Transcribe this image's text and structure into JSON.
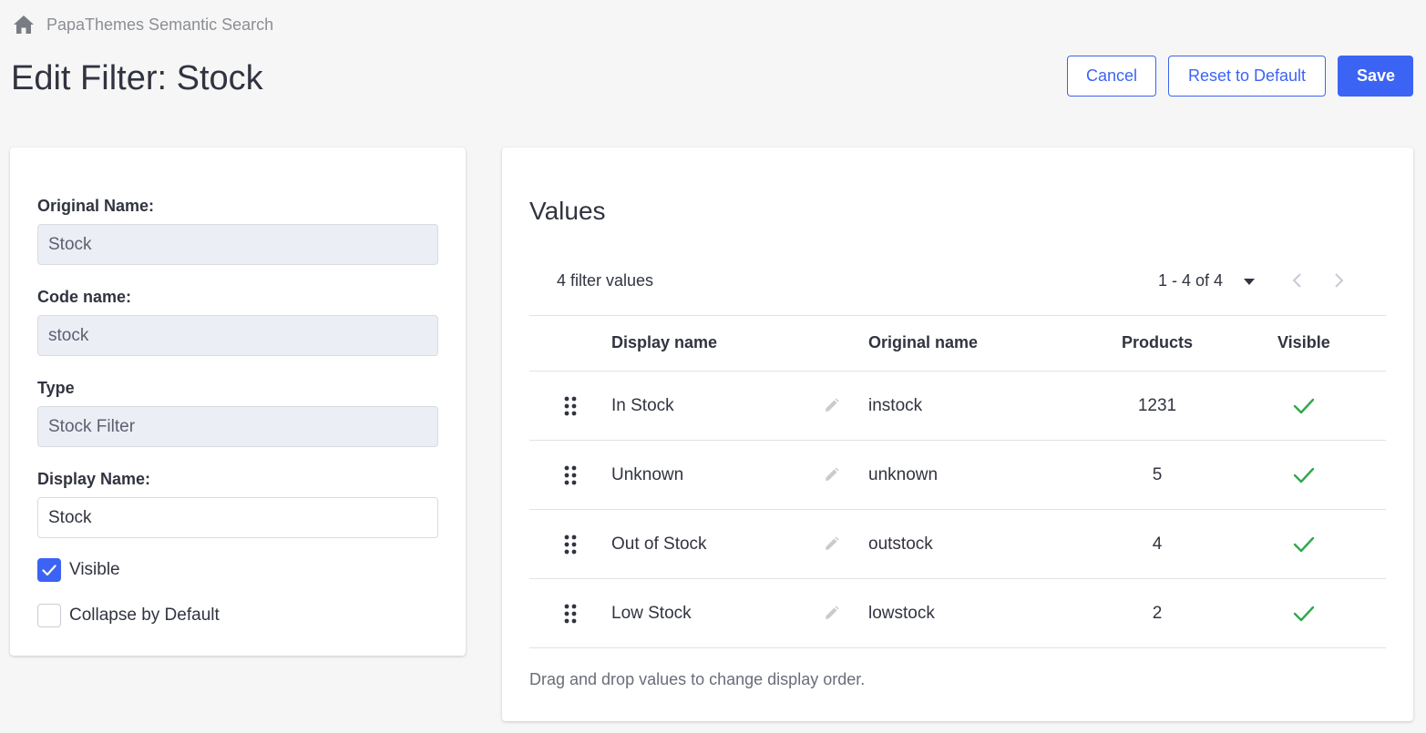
{
  "breadcrumb": {
    "label": "PapaThemes Semantic Search",
    "icon": "home-icon"
  },
  "page": {
    "title": "Edit Filter: Stock"
  },
  "actions": {
    "cancel": "Cancel",
    "reset": "Reset to Default",
    "save": "Save"
  },
  "colors": {
    "accent": "#3c64f4",
    "success": "#2fa84f"
  },
  "form": {
    "original_name": {
      "label": "Original Name:",
      "value": "Stock"
    },
    "code_name": {
      "label": "Code name:",
      "value": "stock"
    },
    "type": {
      "label": "Type",
      "value": "Stock Filter"
    },
    "display_name": {
      "label": "Display Name:",
      "value": "Stock"
    },
    "visible": {
      "label": "Visible",
      "checked": true
    },
    "collapse": {
      "label": "Collapse by Default",
      "checked": false
    }
  },
  "values": {
    "title": "Values",
    "count_text": "4 filter values",
    "pagination": {
      "range": "1 - 4 of 4"
    },
    "columns": {
      "display": "Display name",
      "original": "Original name",
      "products": "Products",
      "visible": "Visible"
    },
    "rows": [
      {
        "display": "In Stock",
        "original": "instock",
        "products": "1231",
        "visible": true
      },
      {
        "display": "Unknown",
        "original": "unknown",
        "products": "5",
        "visible": true
      },
      {
        "display": "Out of Stock",
        "original": "outstock",
        "products": "4",
        "visible": true
      },
      {
        "display": "Low Stock",
        "original": "lowstock",
        "products": "2",
        "visible": true
      }
    ],
    "hint": "Drag and drop values to change display order."
  }
}
